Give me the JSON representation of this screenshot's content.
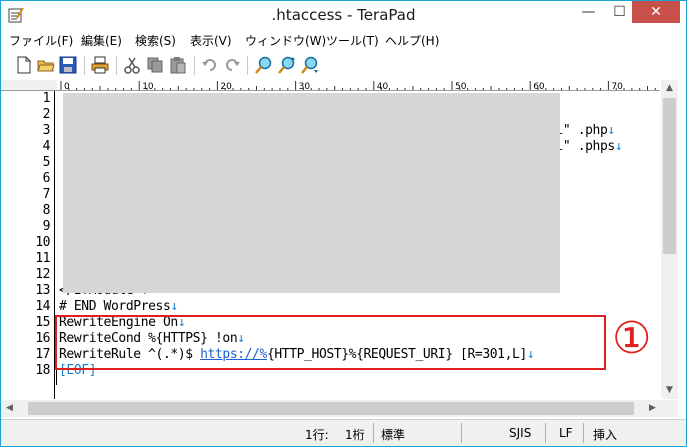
{
  "window": {
    "title": ".htaccess - TeraPad"
  },
  "caption": {
    "minimize": "—",
    "maximize": "☐",
    "close": "✕"
  },
  "menu": [
    "ファイル(F)",
    "編集(E)",
    "検索(S)",
    "表示(V)",
    "ウィンドウ(W)",
    "ツール(T)",
    "ヘルプ(H)"
  ],
  "ruler": {
    "marks": [
      "0",
      "10",
      "20",
      "30",
      "40",
      "50",
      "60",
      "70"
    ]
  },
  "editor": {
    "line_numbers": [
      "1",
      "2",
      "3",
      "4",
      "5",
      "6",
      "7",
      "8",
      "9",
      "10",
      "11",
      "12",
      "13",
      "14",
      "15",
      "16",
      "17",
      "18"
    ],
    "visible_fragments": {
      "line3_tail": "si\" .php",
      "line4_tail": "si\" .phps",
      "line13": "</IfModule>",
      "line14": "# END WordPress",
      "line15": "RewriteEngine On",
      "line16": "RewriteCond %{HTTPS} !on",
      "line17_pre": "RewriteRule ^(.*)$ ",
      "line17_link": "https://%",
      "line17_post": "{HTTP_HOST}%{REQUEST_URI} [R=301,L]",
      "line18": "[EOF]",
      "newline_mark": "↓"
    },
    "annotation": "①",
    "accent_color": "#e02020"
  },
  "status": {
    "row": "1行:",
    "col": "1桁",
    "mode": "標準",
    "encoding": "SJIS",
    "line_ending": "LF",
    "insert": "挿入"
  }
}
